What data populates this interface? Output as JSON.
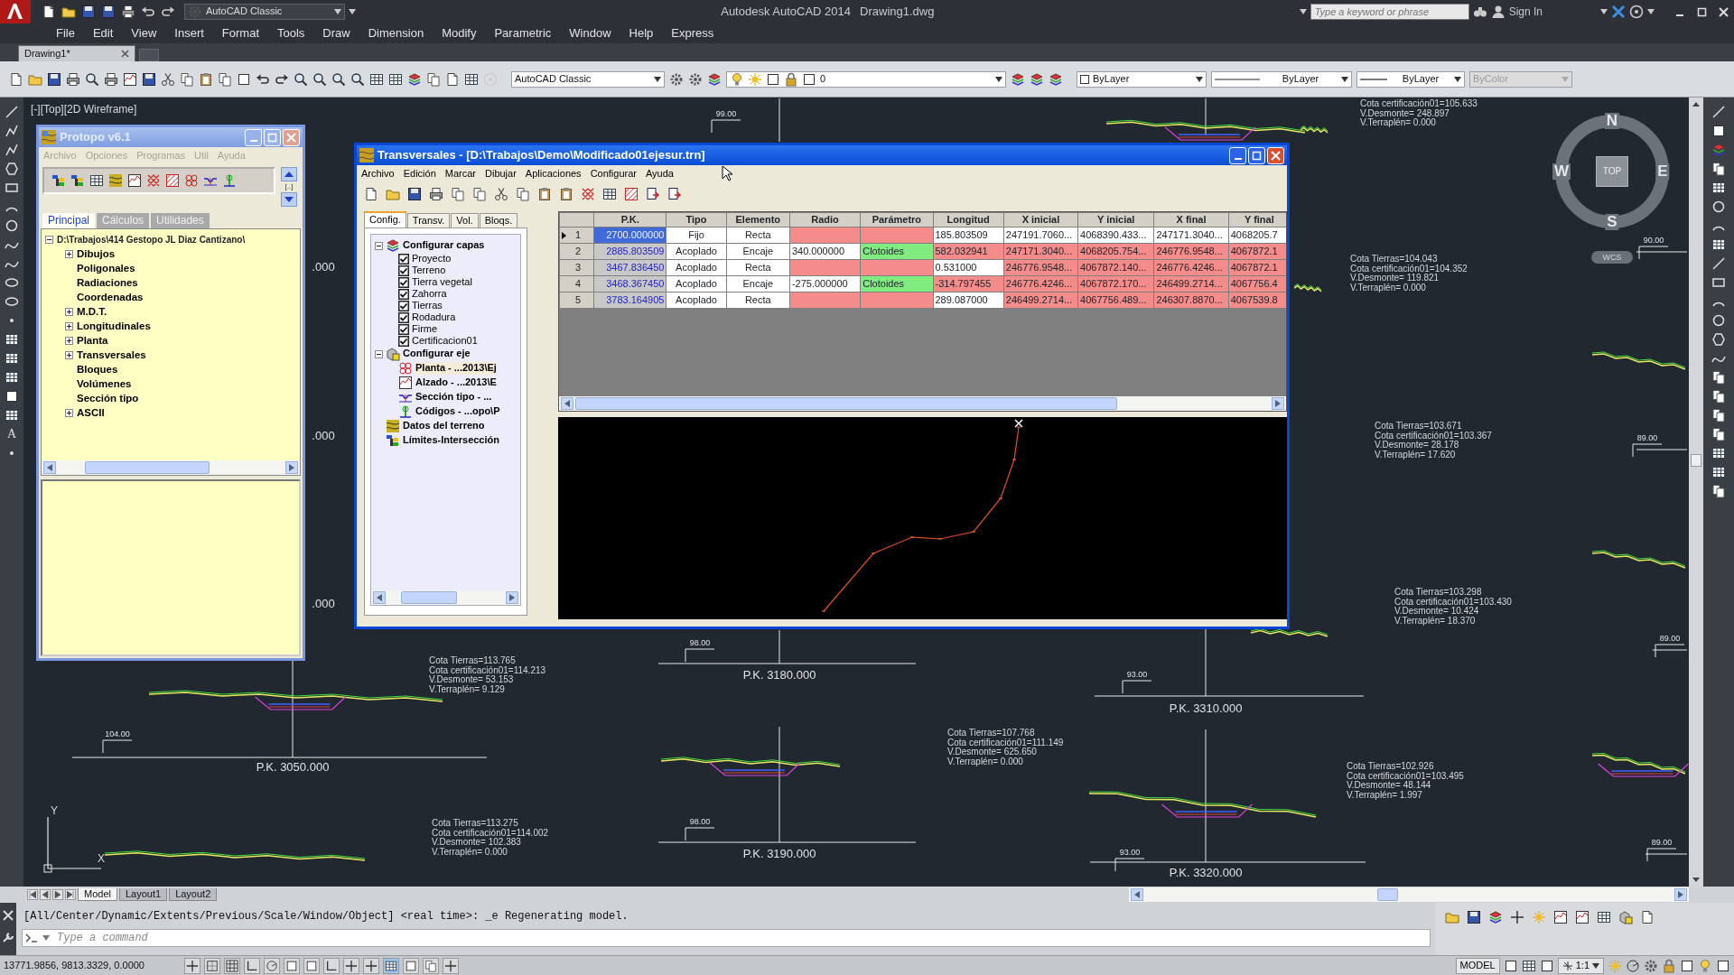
{
  "app_bar": {
    "workspace": "AutoCAD Classic",
    "title": "Autodesk AutoCAD 2014",
    "document": "Drawing1.dwg",
    "search": {
      "placeholder": "Type a keyword or phrase"
    },
    "sign_in": "Sign In"
  },
  "menu": [
    "File",
    "Edit",
    "View",
    "Insert",
    "Format",
    "Tools",
    "Draw",
    "Dimension",
    "Modify",
    "Parametric",
    "Window",
    "Help",
    "Express"
  ],
  "doc_tabs": [
    {
      "label": "Drawing1*",
      "selected": true
    }
  ],
  "properties_toolbar": {
    "workspace": "AutoCAD Classic",
    "layer": "0",
    "color_setting": "ByLayer",
    "linetype": "ByLayer",
    "lineweight": "ByLayer",
    "plot_style": {
      "text": "ByColor",
      "disabled": true
    }
  },
  "draw_toolbar": {
    "text_tool": "A"
  },
  "viewport_label": "[-][Top][2D Wireframe]",
  "compass": {
    "north": "N",
    "south": "S",
    "east": "E",
    "west": "W",
    "top": "TOP",
    "ucs": "WCS"
  },
  "pk_labels": [
    "P.K. 3180.000",
    "P.K. 3310.000",
    "P.K. 3050.000",
    "P.K. 3190.000",
    "P.K. 3320.000"
  ],
  "datum_labels": [
    "99.00",
    "90.00",
    "89.00",
    "89.00",
    "98.00",
    "104.00",
    "93.00",
    "98.00",
    "89.00",
    "93.00"
  ],
  "cut_labels": [
    ".000",
    ".000",
    ".000"
  ],
  "annotations": [
    {
      "lines": [
        "Cota certificación01=105.633",
        "V.Desmonte= 248.897",
        "V.Terraplén= 0.000"
      ]
    },
    {
      "lines": [
        "Cota Tierras=104.043",
        "Cota certificación01=104.352",
        "V.Desmonte= 119.821",
        "V.Terraplén= 0.000"
      ]
    },
    {
      "lines": [
        "Cota Tierras=103.671",
        "Cota certificación01=103.367",
        "V.Desmonte= 28.178",
        "V.Terraplén= 17.620"
      ]
    },
    {
      "lines": [
        "Cota Tierras=103.298",
        "Cota certificación01=103.430",
        "V.Desmonte= 10.424",
        "V.Terraplén= 18.370"
      ]
    },
    {
      "lines": [
        "Cota Tierras=113.765",
        "Cota certificación01=114.213",
        "V.Desmonte= 53.153",
        "V.Terraplén= 9.129"
      ]
    },
    {
      "lines": [
        "Cota Tierras=107.768",
        "Cota certificación01=111.149",
        "V.Desmonte= 625.650",
        "V.Terraplén= 0.000"
      ]
    },
    {
      "lines": [
        "Cota Tierras=102.926",
        "Cota certificación01=103.495",
        "V.Desmonte= 48.144",
        "V.Terraplén= 1.997"
      ]
    },
    {
      "lines": [
        "Cota Tierras=113.275",
        "Cota certificación01=114.002",
        "V.Desmonte= 102.383",
        "V.Terraplén= 0.000"
      ]
    }
  ],
  "ucs_icon": {
    "x_label": "X",
    "y_label": "Y"
  },
  "protopo": {
    "title": "Protopo v6.1",
    "active": false,
    "menu": [
      {
        "label": "Archivo",
        "disabled": true
      },
      {
        "label": "Opciones",
        "disabled": true
      },
      {
        "label": "Programas",
        "disabled": true
      },
      {
        "label": "Util",
        "disabled": true
      },
      {
        "label": "Ayuda",
        "disabled": true
      }
    ],
    "scroll_label": "[..]",
    "tabs": [
      {
        "label": "Principal",
        "selected": true
      },
      {
        "label": "Cálculos",
        "selected": false
      },
      {
        "label": "Utilidades",
        "selected": false
      }
    ],
    "tree": {
      "label": "D:\\Trabajos\\414 Gestopo JL Diaz Cantizano\\",
      "expanded": true,
      "children": [
        {
          "label": "Dibujos",
          "kind": "branch"
        },
        {
          "label": "Poligonales",
          "kind": "leaf"
        },
        {
          "label": "Radiaciones",
          "kind": "leaf"
        },
        {
          "label": "Coordenadas",
          "kind": "leaf"
        },
        {
          "label": "M.D.T.",
          "kind": "branch"
        },
        {
          "label": "Longitudinales",
          "kind": "branch"
        },
        {
          "label": "Planta",
          "kind": "branch"
        },
        {
          "label": "Transversales",
          "kind": "branch"
        },
        {
          "label": "Bloques",
          "kind": "leaf"
        },
        {
          "label": "Volúmenes",
          "kind": "leaf"
        },
        {
          "label": "Sección tipo",
          "kind": "leaf"
        },
        {
          "label": "ASCII",
          "kind": "branch"
        }
      ]
    }
  },
  "transversales": {
    "title": "Transversales - [D:\\Trabajos\\Demo\\Modificado01ejesur.trn]",
    "active": true,
    "menu": [
      "Archivo",
      "Edición",
      "Marcar",
      "Dibujar",
      "Aplicaciones",
      "Configurar",
      "Ayuda"
    ],
    "tabs": [
      {
        "label": "Config.",
        "selected": true
      },
      {
        "label": "Transv.",
        "selected": false
      },
      {
        "label": "Vol.",
        "selected": false
      },
      {
        "label": "Bloqs.",
        "selected": false
      }
    ],
    "tree": [
      {
        "label": "Configurar capas",
        "kind": "group",
        "expanded": true,
        "children": [
          {
            "label": "Proyecto",
            "kind": "checkbox",
            "checked": true
          },
          {
            "label": "Terreno",
            "kind": "checkbox",
            "checked": true
          },
          {
            "label": "Tierra vegetal",
            "kind": "checkbox",
            "checked": true
          },
          {
            "label": "Zahorra",
            "kind": "checkbox",
            "checked": true
          },
          {
            "label": "Tierras",
            "kind": "checkbox",
            "checked": true
          },
          {
            "label": "Rodadura",
            "kind": "checkbox",
            "checked": true
          },
          {
            "label": "Firme",
            "kind": "checkbox",
            "checked": true
          },
          {
            "label": "Certificacion01",
            "kind": "checkbox",
            "checked": true
          }
        ]
      },
      {
        "label": "Configurar eje",
        "kind": "group",
        "expanded": true,
        "children": [
          {
            "label": "Planta - ...2013\\Ej",
            "kind": "file",
            "selected": true
          },
          {
            "label": "Alzado - ...2013\\E",
            "kind": "file",
            "selected": false
          },
          {
            "label": "Sección tipo - ...",
            "kind": "file",
            "selected": false
          },
          {
            "label": "Códigos - ...opo\\P",
            "kind": "file",
            "selected": false
          }
        ]
      },
      {
        "label": "Datos del terreno",
        "kind": "item"
      },
      {
        "label": "Límites-Intersección",
        "kind": "item"
      }
    ],
    "grid": {
      "columns": [
        "P.K.",
        "Tipo",
        "Elemento",
        "Radio",
        "Parámetro",
        "Longitud",
        "X inicial",
        "Y inicial",
        "X final",
        "Y final"
      ],
      "rows": [
        {
          "number": "1",
          "selected": true,
          "cells": [
            {
              "text": "2700.000000"
            },
            {
              "text": "Fijo",
              "color": "#ffffff"
            },
            {
              "text": "Recta",
              "color": "#ffffff"
            },
            {
              "text": "",
              "color": "#f48c8c"
            },
            {
              "text": "",
              "color": "#f48c8c"
            },
            {
              "text": "185.803509",
              "color": "#ffffff"
            },
            {
              "text": "247191.7060...",
              "color": "#ffffff"
            },
            {
              "text": "4068390.433...",
              "color": "#ffffff"
            },
            {
              "text": "247171.3040...",
              "color": "#ffffff"
            },
            {
              "text": "4068205.7",
              "color": "#ffffff"
            }
          ]
        },
        {
          "number": "2",
          "selected": false,
          "cells": [
            {
              "text": "2885.803509"
            },
            {
              "text": "Acoplado",
              "color": "#ffffff"
            },
            {
              "text": "Encaje",
              "color": "#ffffff"
            },
            {
              "text": "340.000000",
              "color": "#ffffff"
            },
            {
              "text": "Clotoides",
              "color": "#80ec80"
            },
            {
              "text": "582.032941",
              "color": "#f48c8c"
            },
            {
              "text": "247171.3040...",
              "color": "#f48c8c"
            },
            {
              "text": "4068205.754...",
              "color": "#f48c8c"
            },
            {
              "text": "246776.9548...",
              "color": "#f48c8c"
            },
            {
              "text": "4067872.1",
              "color": "#f48c8c"
            }
          ]
        },
        {
          "number": "3",
          "selected": false,
          "cells": [
            {
              "text": "3467.836450"
            },
            {
              "text": "Acoplado",
              "color": "#ffffff"
            },
            {
              "text": "Recta",
              "color": "#ffffff"
            },
            {
              "text": "",
              "color": "#f48c8c"
            },
            {
              "text": "",
              "color": "#f48c8c"
            },
            {
              "text": "0.531000",
              "color": "#ffffff"
            },
            {
              "text": "246776.9548...",
              "color": "#f48c8c"
            },
            {
              "text": "4067872.140...",
              "color": "#f48c8c"
            },
            {
              "text": "246776.4246...",
              "color": "#f48c8c"
            },
            {
              "text": "4067872.1",
              "color": "#f48c8c"
            }
          ]
        },
        {
          "number": "4",
          "selected": false,
          "cells": [
            {
              "text": "3468.367450"
            },
            {
              "text": "Acoplado",
              "color": "#ffffff"
            },
            {
              "text": "Encaje",
              "color": "#ffffff"
            },
            {
              "text": "-275.000000",
              "color": "#ffffff"
            },
            {
              "text": "Clotoides",
              "color": "#80ec80"
            },
            {
              "text": "-314.797455",
              "color": "#f48c8c"
            },
            {
              "text": "246776.4246...",
              "color": "#f48c8c"
            },
            {
              "text": "4067872.170...",
              "color": "#f48c8c"
            },
            {
              "text": "246499.2714...",
              "color": "#f48c8c"
            },
            {
              "text": "4067756.4",
              "color": "#f48c8c"
            }
          ]
        },
        {
          "number": "5",
          "selected": false,
          "cells": [
            {
              "text": "3783.164905"
            },
            {
              "text": "Acoplado",
              "color": "#ffffff"
            },
            {
              "text": "Recta",
              "color": "#ffffff"
            },
            {
              "text": "",
              "color": "#f48c8c"
            },
            {
              "text": "",
              "color": "#f48c8c"
            },
            {
              "text": "289.087000",
              "color": "#ffffff"
            },
            {
              "text": "246499.2714...",
              "color": "#f48c8c"
            },
            {
              "text": "4067756.489...",
              "color": "#f48c8c"
            },
            {
              "text": "246307.8870...",
              "color": "#f48c8c"
            },
            {
              "text": "4067539.8",
              "color": "#f48c8c"
            }
          ]
        }
      ]
    }
  },
  "layout_tabs": [
    {
      "label": "Model",
      "selected": true
    },
    {
      "label": "Layout1",
      "selected": false
    },
    {
      "label": "Layout2",
      "selected": false
    }
  ],
  "command": {
    "history": "[All/Center/Dynamic/Extents/Previous/Scale/Window/Object] <real time>: _e Regenerating model.",
    "placeholder": "Type a command"
  },
  "status_bar": {
    "coordinates": "13771.9856, 9813.3329, 0.0000",
    "space": "MODEL",
    "scale": "1:1"
  }
}
